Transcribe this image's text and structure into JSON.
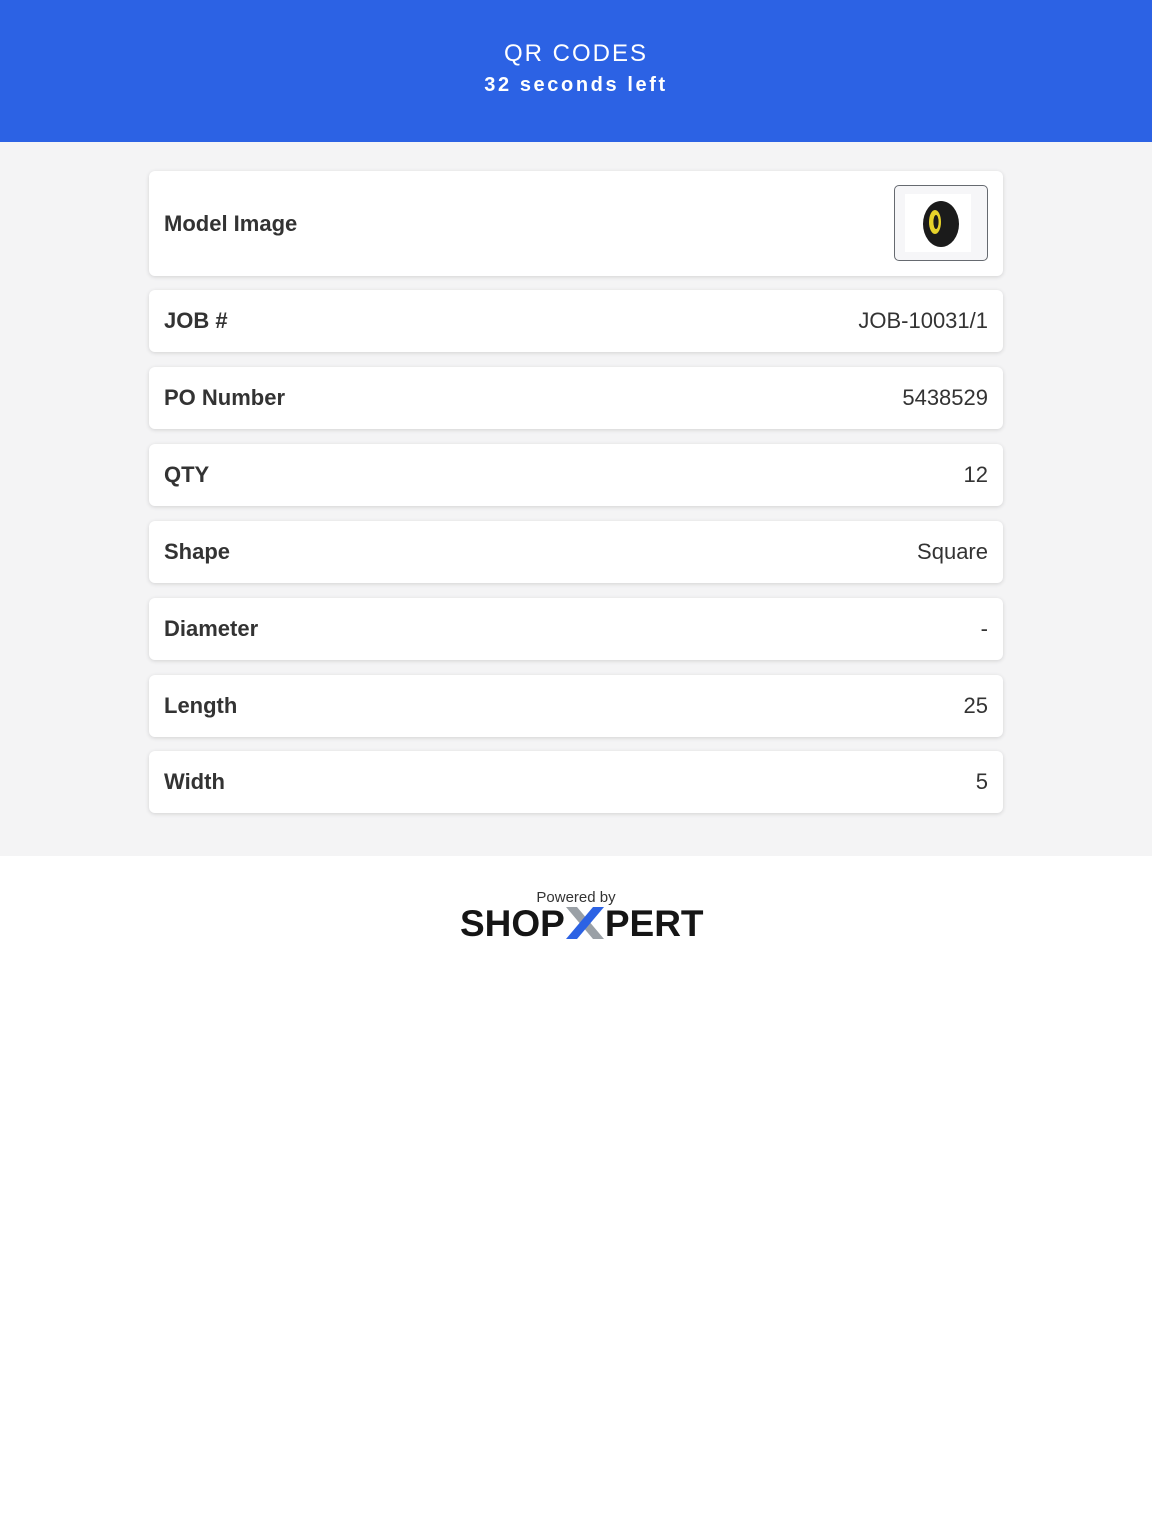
{
  "header": {
    "title": "QR CODES",
    "countdown": "32 seconds left"
  },
  "details": {
    "model_image_label": "Model Image",
    "model_image_icon": "tire-roll-icon",
    "rows": [
      {
        "label": "JOB #",
        "value": "JOB-10031/1"
      },
      {
        "label": "PO Number",
        "value": "5438529"
      },
      {
        "label": "QTY",
        "value": "12"
      },
      {
        "label": "Shape",
        "value": "Square"
      },
      {
        "label": "Diameter",
        "value": "-"
      },
      {
        "label": "Length",
        "value": "25"
      },
      {
        "label": "Width",
        "value": "5"
      }
    ]
  },
  "footer": {
    "powered_by": "Powered by",
    "brand_left": "SHOP",
    "brand_right": "PERT",
    "brand_mark_letter": "X"
  },
  "colors": {
    "header_bg": "#2c62e4",
    "content_bg": "#f4f4f5",
    "brand_x_blue": "#2c62e4",
    "brand_x_gray": "#9aa0a6"
  }
}
